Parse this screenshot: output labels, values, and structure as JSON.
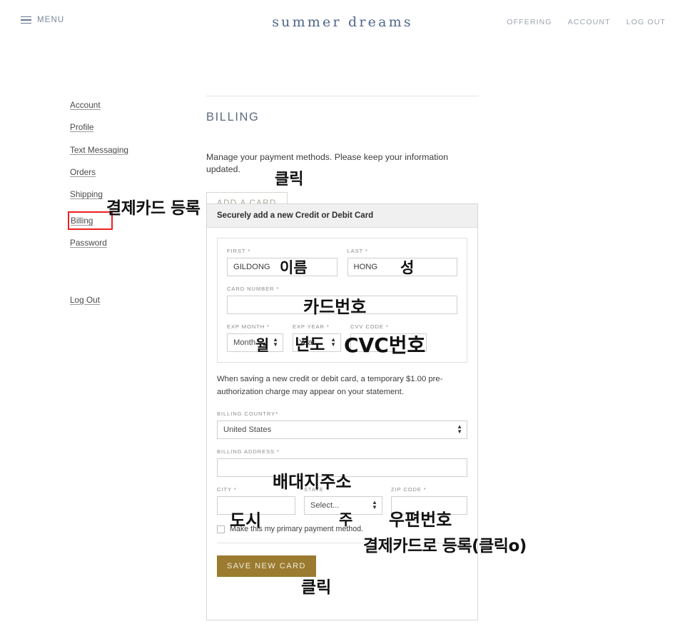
{
  "header": {
    "menu_label": "MENU",
    "brand": "summer dreams",
    "nav": [
      {
        "label": "OFFERING"
      },
      {
        "label": "ACCOUNT"
      },
      {
        "label": "LOG OUT"
      }
    ]
  },
  "sidebar": {
    "items": [
      {
        "label": "Account"
      },
      {
        "label": "Profile"
      },
      {
        "label": "Text Messaging"
      },
      {
        "label": "Orders"
      },
      {
        "label": "Shipping"
      },
      {
        "label": "Billing"
      },
      {
        "label": "Password"
      }
    ],
    "logout": {
      "label": "Log Out"
    },
    "highlight_color": "#ef2020"
  },
  "main": {
    "title": "BILLING",
    "description": "Manage your payment methods. Please keep your information updated.",
    "add_card_label": "ADD A CARD"
  },
  "modal": {
    "title": "Securely add a new Credit or Debit Card",
    "fields": {
      "first": {
        "label": "FIRST *",
        "value": "GILDONG"
      },
      "last": {
        "label": "LAST *",
        "value": "HONG"
      },
      "card_number": {
        "label": "CARD NUMBER *",
        "value": ""
      },
      "exp_month": {
        "label": "EXP MONTH *",
        "value": "Month"
      },
      "exp_year": {
        "label": "EXP YEAR *",
        "value": "Year"
      },
      "cvv": {
        "label": "CVV CODE *",
        "value": ""
      },
      "billing_country": {
        "label": "BILLING COUNTRY*",
        "value": "United States"
      },
      "billing_address": {
        "label": "BILLING ADDRESS *",
        "value": ""
      },
      "city": {
        "label": "CITY *",
        "value": ""
      },
      "state": {
        "label": "STATE *",
        "value": "Select..."
      },
      "zip": {
        "label": "ZIP CODE *",
        "value": ""
      }
    },
    "preauth_notice": "When saving a new credit or debit card, a temporary $1.00 pre-authorization charge may appear on your statement.",
    "primary_checkbox_label": "Make this my primary payment method.",
    "save_label": "SAVE NEW CARD",
    "save_color": "#9b7b2f"
  },
  "annotations": {
    "billing_nav": "결제카드  등록",
    "add_card": "클릭",
    "first_name": "이름",
    "last_name": "성",
    "card_number": "카드번호",
    "exp_month": "월",
    "exp_year": "년도",
    "cvv": "CVC번호",
    "billing_address": "배대지주소",
    "city": "도시",
    "state": "주",
    "zip": "우편번호",
    "primary_checkbox": "결제카드로  등록(클릭o)",
    "save": "클릭"
  }
}
